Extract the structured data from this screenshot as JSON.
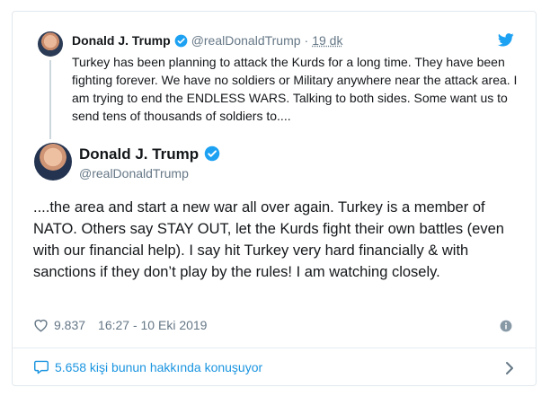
{
  "parent_tweet": {
    "name": "Donald J. Trump",
    "handle": "@realDonaldTrump",
    "separator": "·",
    "time": "19 dk",
    "text": "Turkey has been planning to attack the Kurds for a long time. They have been fighting forever. We have no soldiers or Military anywhere near the attack area. I am trying to end the ENDLESS WARS. Talking to both sides. Some want us to send tens of thousands of soldiers to...."
  },
  "main_tweet": {
    "name": "Donald J. Trump",
    "handle": "@realDonaldTrump",
    "text": "....the area and start a new war all over again. Turkey is a member of NATO. Others say STAY OUT, let the Kurds fight their own battles (even with our financial help). I say hit Turkey very hard financially & with sanctions if they don’t play by the rules! I am watching closely.",
    "likes": "9.837",
    "timestamp": "16:27 - 10 Eki 2019"
  },
  "footer": {
    "conversation_label": "5.658 kişi bunun hakkında konuşuyor"
  },
  "colors": {
    "accent": "#1b95e0",
    "verified": "#1da1f2",
    "muted": "#657786",
    "border": "#e1e8ed"
  },
  "icons": [
    "twitter-bird-icon",
    "verified-badge-icon",
    "heart-icon",
    "info-icon",
    "comment-bubble-icon",
    "chevron-right-icon"
  ]
}
